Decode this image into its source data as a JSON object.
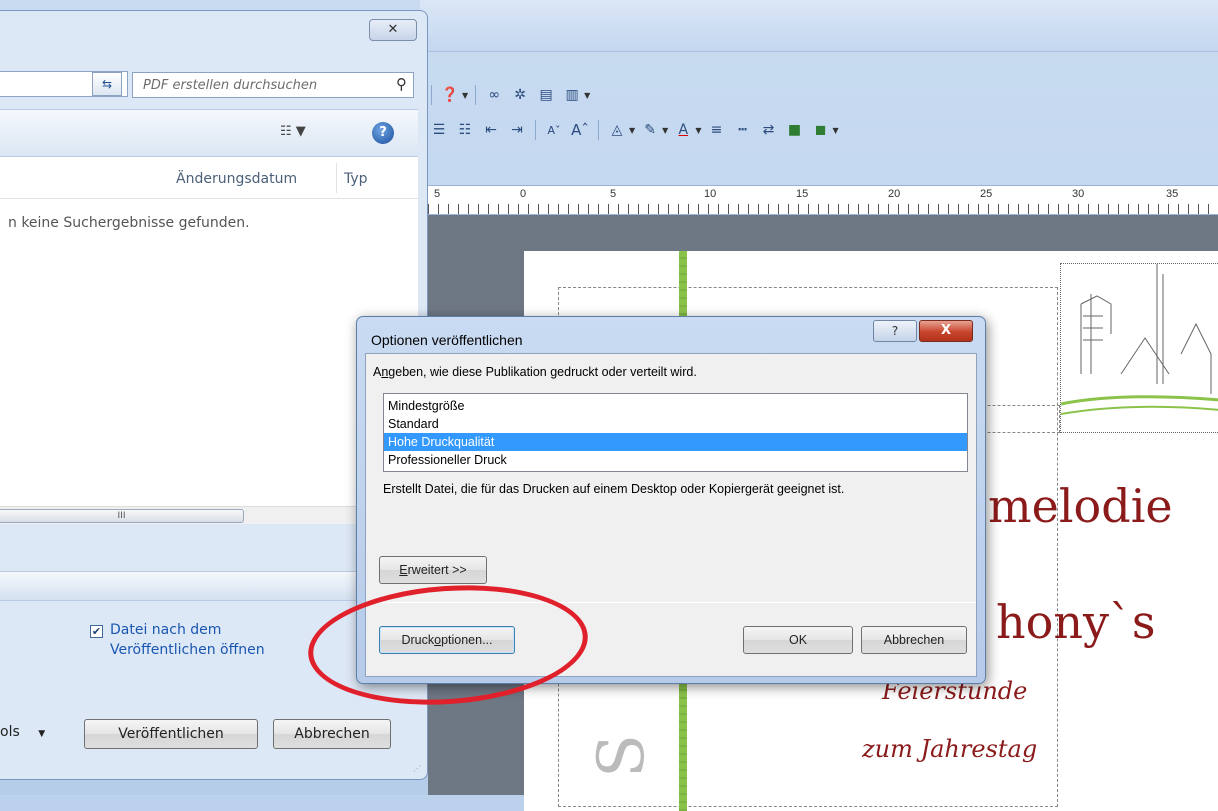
{
  "publisher": {
    "ruler_numbers": [
      "5",
      "0",
      "5",
      "10",
      "15",
      "20",
      "25",
      "30",
      "35"
    ],
    "document": {
      "heading_fragment": "melodie",
      "name_fragment": "hony`s",
      "line_subtitle": "Feierstunde",
      "line_occasion": "zum Jahrestag",
      "vertical_fragment": "S"
    }
  },
  "save_dialog": {
    "close_glyph": "✕",
    "search_placeholder": "PDF erstellen durchsuchen",
    "columns": {
      "date": "Änderungsdatum",
      "type": "Typ"
    },
    "empty_message": "n keine Suchergebnisse gefunden.",
    "scroll_thumb": "III",
    "open_after_publish": {
      "checked": true,
      "label": "Datei nach dem Veröffentlichen öffnen"
    },
    "tools_label": "ols",
    "publish_button": "Veröffentlichen",
    "cancel_button": "Abbrechen"
  },
  "options_dialog": {
    "title": "Optionen veröffentlichen",
    "help_glyph": "?",
    "close_glyph": "X",
    "instruction_prefix": "A",
    "instruction_mnemonic": "n",
    "instruction_rest": "geben, wie diese Publikation gedruckt oder verteilt wird.",
    "options": [
      {
        "label": "Mindestgröße",
        "selected": false
      },
      {
        "label": "Standard",
        "selected": false
      },
      {
        "label": "Hohe Druckqualität",
        "selected": true
      },
      {
        "label": "Professioneller Druck",
        "selected": false
      }
    ],
    "description": "Erstellt Datei, die für das Drucken auf einem Desktop oder Kopiergerät geeignet ist.",
    "advanced_mnemonic": "E",
    "advanced_rest": "rweitert >>",
    "print_options_prefix": "Druck",
    "print_options_mnemonic": "o",
    "print_options_rest": "ptionen...",
    "ok_button": "OK",
    "cancel_button": "Abbrechen"
  },
  "colors": {
    "selection": "#3399ff",
    "annotation_ring": "#e0202a",
    "document_text": "#8b1a1a",
    "link_text": "#1a56b0"
  }
}
